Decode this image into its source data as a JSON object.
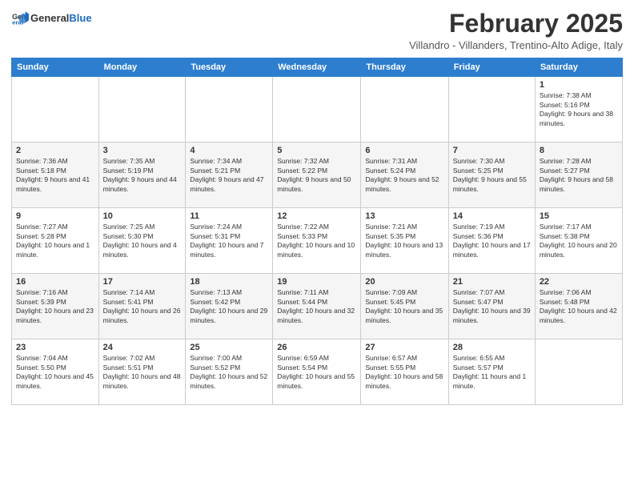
{
  "header": {
    "logo_general": "General",
    "logo_blue": "Blue",
    "title": "February 2025",
    "subtitle": "Villandro - Villanders, Trentino-Alto Adige, Italy"
  },
  "days_of_week": [
    "Sunday",
    "Monday",
    "Tuesday",
    "Wednesday",
    "Thursday",
    "Friday",
    "Saturday"
  ],
  "weeks": [
    [
      {
        "day": "",
        "info": ""
      },
      {
        "day": "",
        "info": ""
      },
      {
        "day": "",
        "info": ""
      },
      {
        "day": "",
        "info": ""
      },
      {
        "day": "",
        "info": ""
      },
      {
        "day": "",
        "info": ""
      },
      {
        "day": "1",
        "info": "Sunrise: 7:38 AM\nSunset: 5:16 PM\nDaylight: 9 hours and 38 minutes."
      }
    ],
    [
      {
        "day": "2",
        "info": "Sunrise: 7:36 AM\nSunset: 5:18 PM\nDaylight: 9 hours and 41 minutes."
      },
      {
        "day": "3",
        "info": "Sunrise: 7:35 AM\nSunset: 5:19 PM\nDaylight: 9 hours and 44 minutes."
      },
      {
        "day": "4",
        "info": "Sunrise: 7:34 AM\nSunset: 5:21 PM\nDaylight: 9 hours and 47 minutes."
      },
      {
        "day": "5",
        "info": "Sunrise: 7:32 AM\nSunset: 5:22 PM\nDaylight: 9 hours and 50 minutes."
      },
      {
        "day": "6",
        "info": "Sunrise: 7:31 AM\nSunset: 5:24 PM\nDaylight: 9 hours and 52 minutes."
      },
      {
        "day": "7",
        "info": "Sunrise: 7:30 AM\nSunset: 5:25 PM\nDaylight: 9 hours and 55 minutes."
      },
      {
        "day": "8",
        "info": "Sunrise: 7:28 AM\nSunset: 5:27 PM\nDaylight: 9 hours and 58 minutes."
      }
    ],
    [
      {
        "day": "9",
        "info": "Sunrise: 7:27 AM\nSunset: 5:28 PM\nDaylight: 10 hours and 1 minute."
      },
      {
        "day": "10",
        "info": "Sunrise: 7:25 AM\nSunset: 5:30 PM\nDaylight: 10 hours and 4 minutes."
      },
      {
        "day": "11",
        "info": "Sunrise: 7:24 AM\nSunset: 5:31 PM\nDaylight: 10 hours and 7 minutes."
      },
      {
        "day": "12",
        "info": "Sunrise: 7:22 AM\nSunset: 5:33 PM\nDaylight: 10 hours and 10 minutes."
      },
      {
        "day": "13",
        "info": "Sunrise: 7:21 AM\nSunset: 5:35 PM\nDaylight: 10 hours and 13 minutes."
      },
      {
        "day": "14",
        "info": "Sunrise: 7:19 AM\nSunset: 5:36 PM\nDaylight: 10 hours and 17 minutes."
      },
      {
        "day": "15",
        "info": "Sunrise: 7:17 AM\nSunset: 5:38 PM\nDaylight: 10 hours and 20 minutes."
      }
    ],
    [
      {
        "day": "16",
        "info": "Sunrise: 7:16 AM\nSunset: 5:39 PM\nDaylight: 10 hours and 23 minutes."
      },
      {
        "day": "17",
        "info": "Sunrise: 7:14 AM\nSunset: 5:41 PM\nDaylight: 10 hours and 26 minutes."
      },
      {
        "day": "18",
        "info": "Sunrise: 7:13 AM\nSunset: 5:42 PM\nDaylight: 10 hours and 29 minutes."
      },
      {
        "day": "19",
        "info": "Sunrise: 7:11 AM\nSunset: 5:44 PM\nDaylight: 10 hours and 32 minutes."
      },
      {
        "day": "20",
        "info": "Sunrise: 7:09 AM\nSunset: 5:45 PM\nDaylight: 10 hours and 35 minutes."
      },
      {
        "day": "21",
        "info": "Sunrise: 7:07 AM\nSunset: 5:47 PM\nDaylight: 10 hours and 39 minutes."
      },
      {
        "day": "22",
        "info": "Sunrise: 7:06 AM\nSunset: 5:48 PM\nDaylight: 10 hours and 42 minutes."
      }
    ],
    [
      {
        "day": "23",
        "info": "Sunrise: 7:04 AM\nSunset: 5:50 PM\nDaylight: 10 hours and 45 minutes."
      },
      {
        "day": "24",
        "info": "Sunrise: 7:02 AM\nSunset: 5:51 PM\nDaylight: 10 hours and 48 minutes."
      },
      {
        "day": "25",
        "info": "Sunrise: 7:00 AM\nSunset: 5:52 PM\nDaylight: 10 hours and 52 minutes."
      },
      {
        "day": "26",
        "info": "Sunrise: 6:59 AM\nSunset: 5:54 PM\nDaylight: 10 hours and 55 minutes."
      },
      {
        "day": "27",
        "info": "Sunrise: 6:57 AM\nSunset: 5:55 PM\nDaylight: 10 hours and 58 minutes."
      },
      {
        "day": "28",
        "info": "Sunrise: 6:55 AM\nSunset: 5:57 PM\nDaylight: 11 hours and 1 minute."
      },
      {
        "day": "",
        "info": ""
      }
    ]
  ]
}
